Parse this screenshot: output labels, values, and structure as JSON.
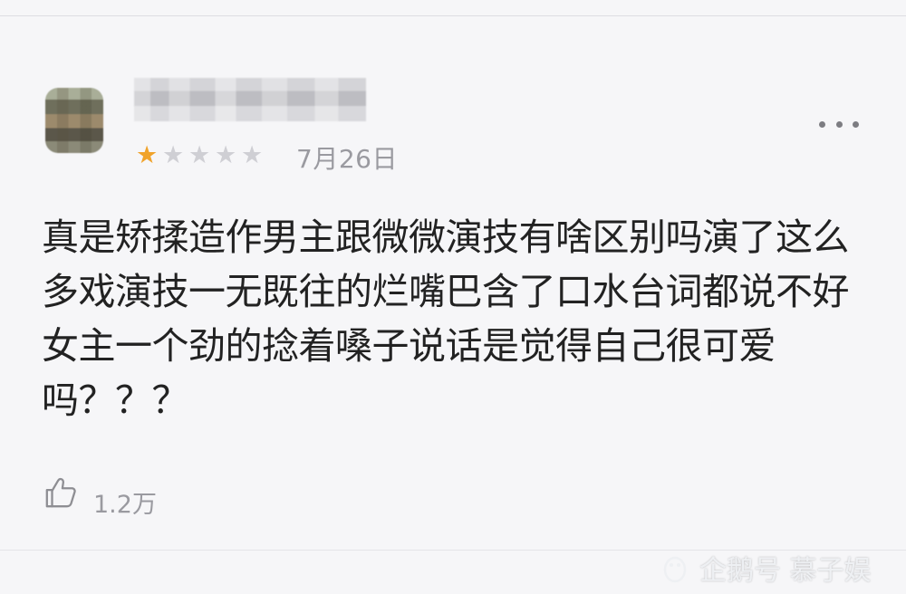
{
  "review": {
    "rating": 1,
    "rating_max": 5,
    "date": "7月26日",
    "text": "真是矫揉造作男主跟微微演技有啥区别吗演了这么多戏演技一无既往的烂嘴巴含了口水台词都说不好女主一个劲的捻着嗓子说话是觉得自己很可爱吗？？？",
    "likes": "1.2万"
  },
  "icons": {
    "avatar": "avatar-pixelated",
    "username": "username-pixelated",
    "more": "more-dots-icon",
    "like": "thumbs-up-icon",
    "watermark_logo": "penguin-icon"
  },
  "colors": {
    "star_filled": "#f0a32b",
    "star_empty": "#cfcfd4",
    "text": "#222222",
    "meta": "#9a9aa0",
    "background": "#f6f6f8"
  },
  "watermark": "企鹅号 慕子娱"
}
